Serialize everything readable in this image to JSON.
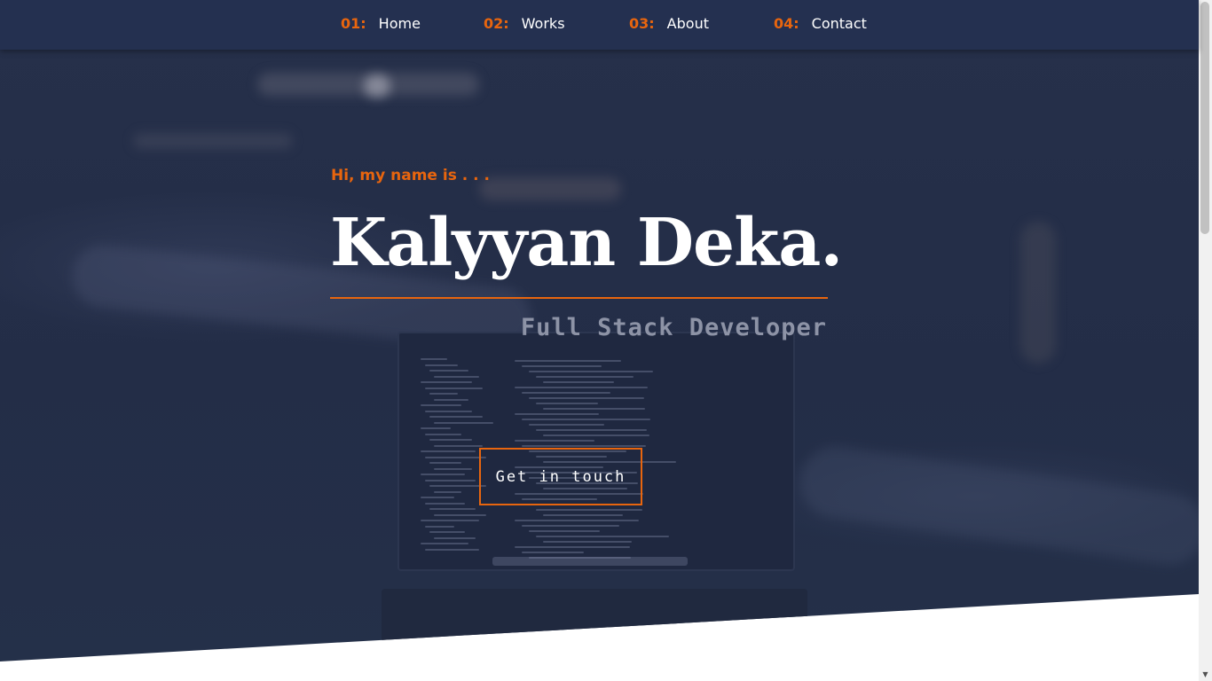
{
  "nav": {
    "items": [
      {
        "number": "01:",
        "label": "Home"
      },
      {
        "number": "02:",
        "label": "Works"
      },
      {
        "number": "03:",
        "label": "About"
      },
      {
        "number": "04:",
        "label": "Contact"
      }
    ]
  },
  "hero": {
    "greeting": "Hi, my name is . . .",
    "name": "Kalyyan Deka.",
    "role": "Full Stack Developer",
    "cta_label": "Get in touch",
    "background_image": "laptop-with-code-photo"
  },
  "colors": {
    "accent": "#e8650e",
    "nav_background": "#243050",
    "hero_overlay": "#26304a",
    "text_primary": "#ffffff",
    "text_muted": "#8d93a6"
  }
}
